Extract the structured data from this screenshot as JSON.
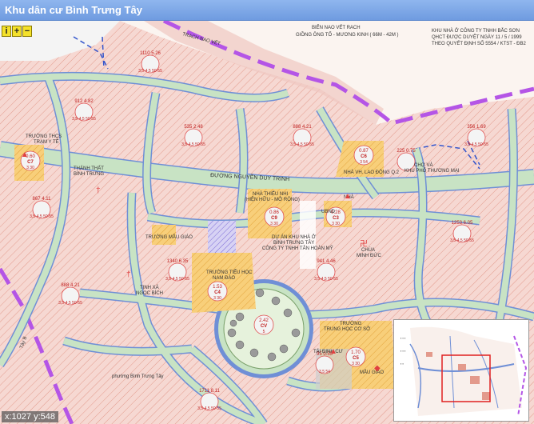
{
  "window": {
    "title": "Khu dân cư Bình Trưng Tây"
  },
  "controls": {
    "info": "i",
    "zoom_in": "+",
    "zoom_out": "−"
  },
  "status": {
    "coords": "x:1027 y:548"
  },
  "colors": {
    "residential": "#f6d8d2",
    "road_fill": "#c8e3c4",
    "road_edge": "#6f8fd6",
    "boundary": "#b455e6",
    "school": "#f4c66e",
    "park": "#8fd48f"
  },
  "labels": {
    "road_label": "ĐƯỜNG  NGUYỄN DUY TRINH",
    "north_annotation_1": "BIỂN NAO VẾT RACH",
    "north_annotation_2": "GIỒNG ÔNG TỐ - MƯƠNG KINH ( 66M - 42M )",
    "top_small": "TRẠCH NAO VẾT",
    "ne_note_1": "KHU NHÀ Ở CÔNG TY TNHH BẮC SƠN",
    "ne_note_2": "QHCT ĐƯỢC DUYỆT NGÀY 11 / 5 / 1999",
    "ne_note_3": "THEO QUYẾT ĐỊNH SỐ 5554 / KTST - ĐB2",
    "church_thanh_that": "TRƯỜNG THCS",
    "church_thanh_that_2": "TRẠM Y TẾ",
    "thanh_that": "THÁNH THẤT",
    "thanh_that_2": "BÌNH TRƯNG",
    "nha_vh": "NHÀ VH. LAO ĐỘNG Q.2",
    "cho_va": "CHỢ VÀ",
    "cho_va_2": "KHU PHỐ THƯƠNG MẠI",
    "nha_thieu_nhi": "NHÀ THIẾU NHI",
    "nha_thieu_nhi_2": "(HIỆN HỮU - MỞ RỘNG)",
    "ubnd": "UBND",
    "nha": "NHÀ",
    "du_an": "DỰ ÁN KHU NHÀ Ở",
    "du_an_2": "BÌNH TRƯNG TÂY",
    "du_an_3": "CÔNG TY TNHH TÂN HOÀN MỸ",
    "chua_minh_duc": "CHÙA",
    "chua_minh_duc_2": "MINH ĐỨC",
    "truong_mau_giao": "TRƯỜNG MẪU GIÁO",
    "tinh_xa": "TỊNH XÁ",
    "tinh_xa_2": "NGỌC BÍCH",
    "truong_tieu_hoc": "TRƯỜNG TIỂU HỌC",
    "truong_tieu_hoc_2": "NAM ĐÀO",
    "truong_thcs": "TRƯỜNG",
    "truong_thcs_2": "TRUNG HỌC CƠ SỞ",
    "tai_dinh_cu": "TÁI ĐỊNH CƯ",
    "mau_giao_2": "MẪU GIÁO",
    "phuong": "phường Bình Trưng Tây",
    "tay": "Tây B"
  },
  "plots": [
    {
      "name": "plot-912",
      "top": "912",
      "mid": "4.82",
      "bot": "3,5-4,5  50-55"
    },
    {
      "name": "plot-1110",
      "top": "1110",
      "mid": "5.26",
      "bot": "3,5-4,5  50-55"
    },
    {
      "name": "plot-535",
      "top": "535",
      "mid": "2.48",
      "bot": "3,5-4,5  50-55"
    },
    {
      "name": "plot-888",
      "top": "888",
      "mid": "4.21",
      "bot": "3,5-4,5  50-55"
    },
    {
      "name": "plot-356",
      "top": "356",
      "mid": "1.69",
      "bot": "3,5-4,5  50-55"
    },
    {
      "name": "plot-225",
      "top": "225",
      "mid": "0.75",
      "bot": ""
    },
    {
      "name": "plot-867",
      "top": "867",
      "mid": "4.11",
      "bot": "3,5-4,5  50-55"
    },
    {
      "name": "plot-1253",
      "top": "1253",
      "mid": "6.05",
      "bot": "3,5-4,5  50-55"
    },
    {
      "name": "plot-1340",
      "top": "1340",
      "mid": "6.35",
      "bot": "3,5-4,5  50-55"
    },
    {
      "name": "plot-941",
      "top": "941",
      "mid": "4.46",
      "bot": "3,5-4,5  50-55"
    },
    {
      "name": "plot-888b",
      "top": "888",
      "mid": "4.21",
      "bot": "3,5-4,5  50-55"
    },
    {
      "name": "plot-1711",
      "top": "1711",
      "mid": "8.11",
      "bot": "3,5-4,5  50-55"
    },
    {
      "name": "plot-95",
      "top": "95",
      "mid": "0.55",
      "bot": "3,5  54"
    }
  ],
  "schools": [
    {
      "name": "school-c6",
      "top": "0.87",
      "code": "C6",
      "bot": "3   54"
    },
    {
      "name": "school-c7",
      "top": "0.60",
      "code": "C7",
      "bot": "3   30"
    },
    {
      "name": "school-c9",
      "top": "0.86",
      "code": "C9",
      "bot": "3   30"
    },
    {
      "name": "school-c3",
      "top": "0.28",
      "code": "C3",
      "bot": "3   30"
    },
    {
      "name": "school-c4",
      "top": "1.53",
      "code": "C4",
      "bot": "3   30"
    },
    {
      "name": "school-c5",
      "top": "1.70",
      "code": "C5",
      "bot": "3   30"
    },
    {
      "name": "park-cv",
      "top": "2.42",
      "code": "CV",
      "bot": "5"
    }
  ]
}
